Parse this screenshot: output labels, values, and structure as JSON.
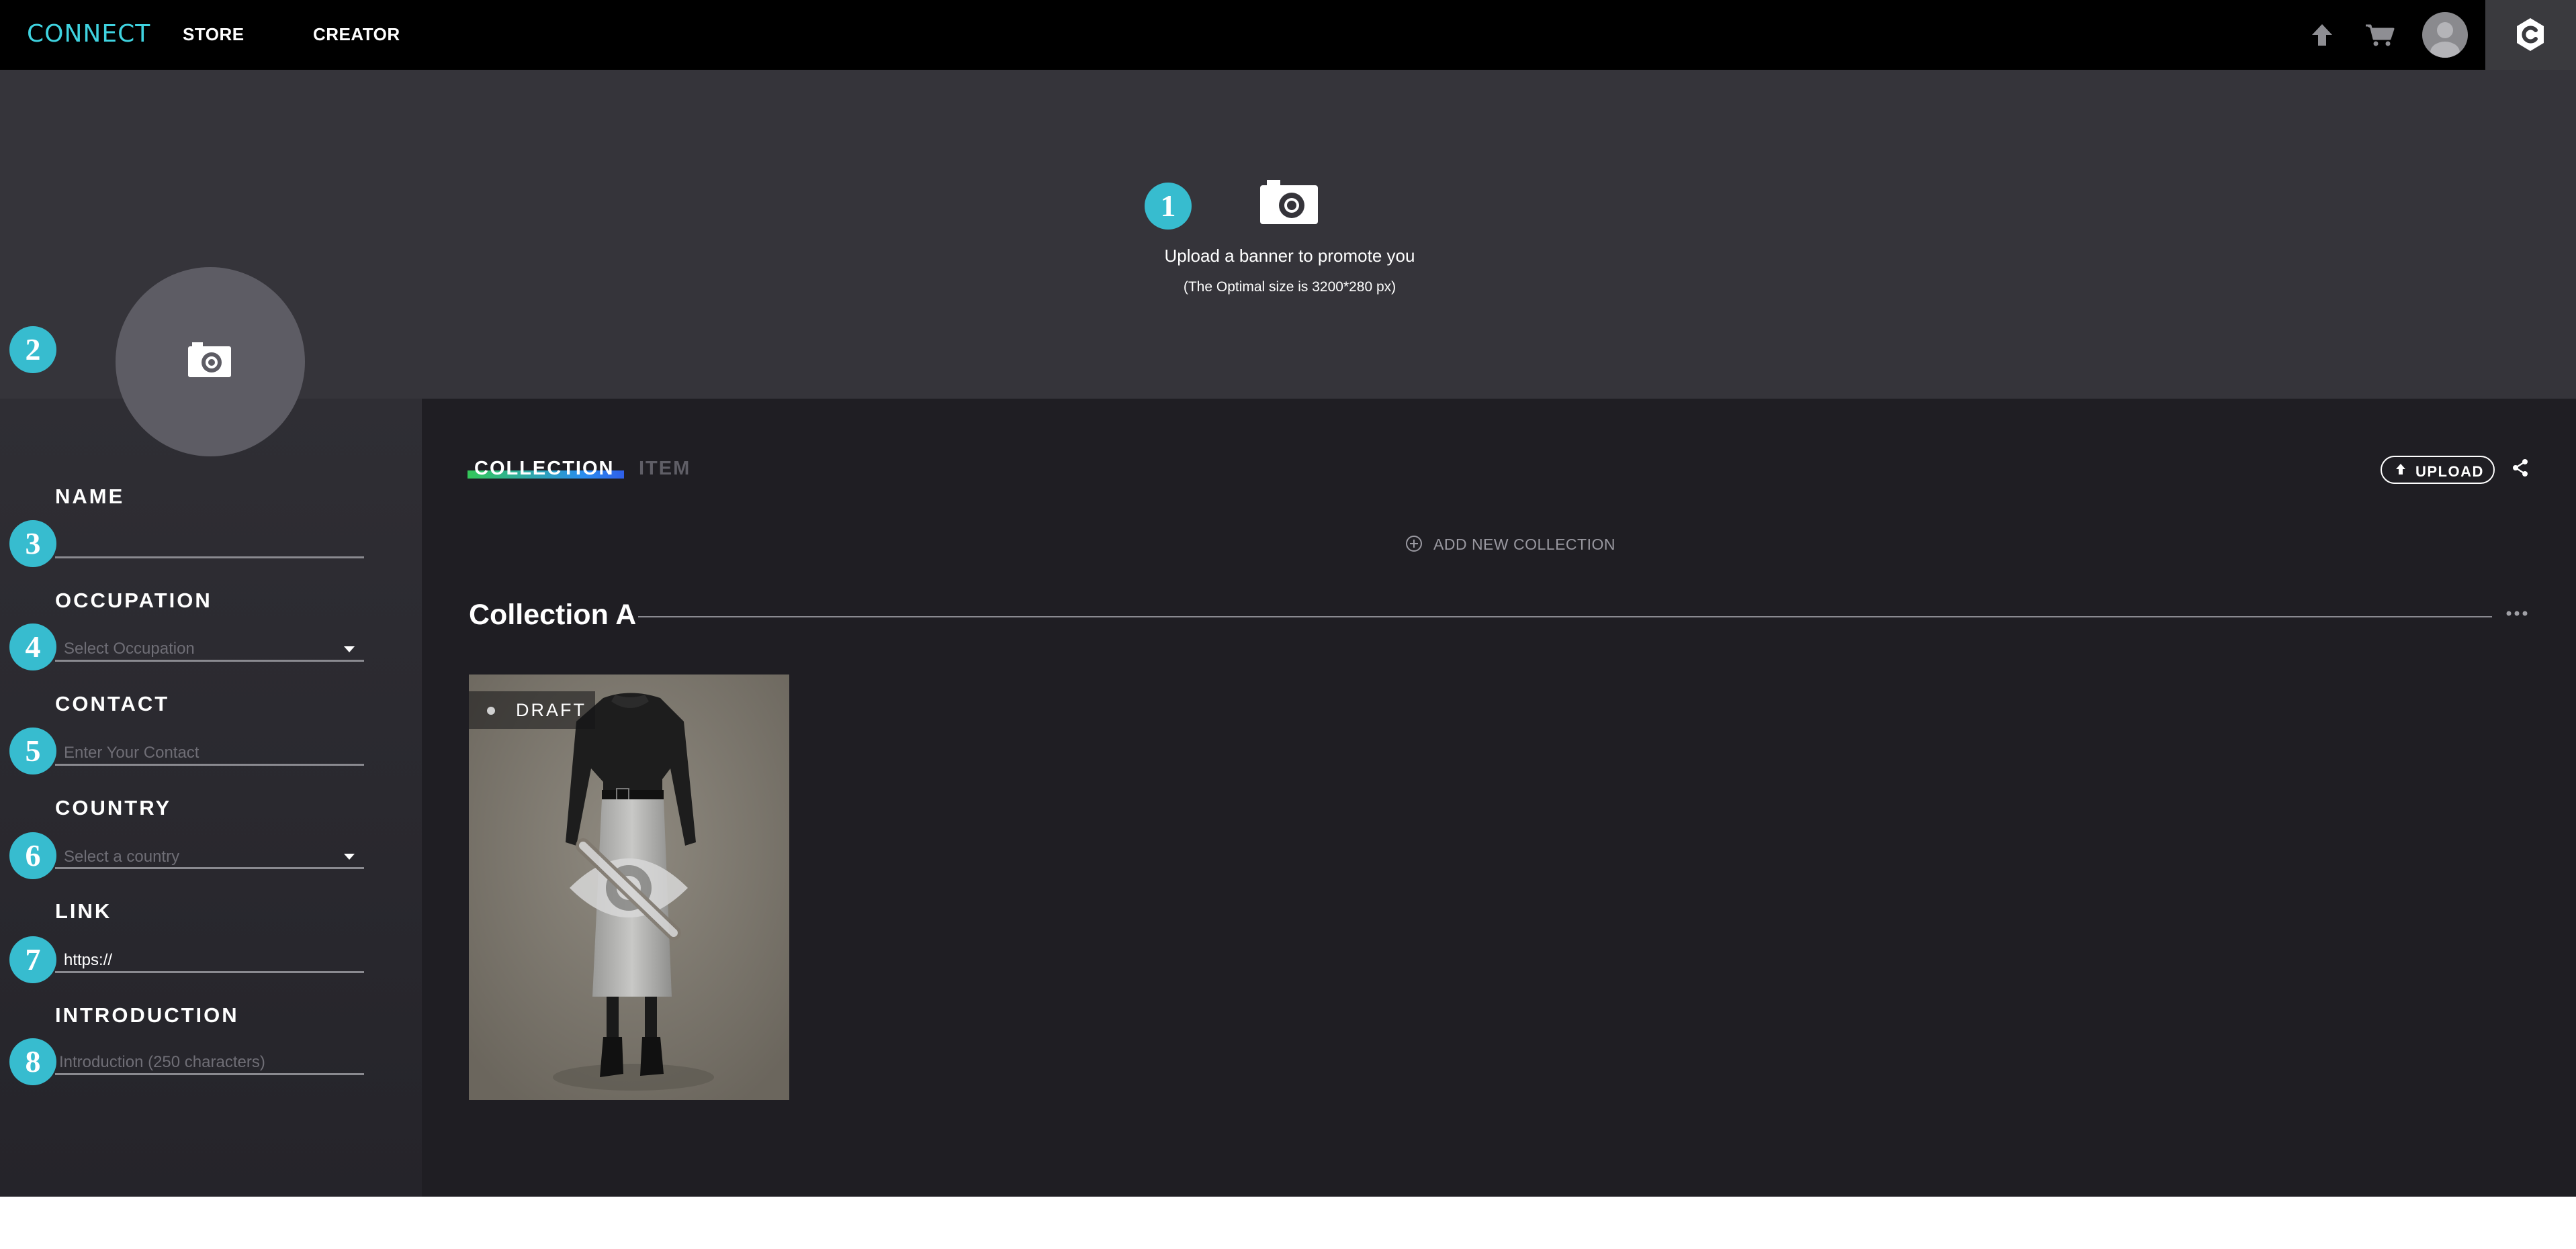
{
  "nav": {
    "logo": "CONNECT",
    "links": [
      "STORE",
      "CREATOR"
    ]
  },
  "banner": {
    "title": "Upload a banner to promote you",
    "subtitle": "(The Optimal size is 3200*280 px)"
  },
  "badges": [
    "1",
    "2",
    "3",
    "4",
    "5",
    "6",
    "7",
    "8"
  ],
  "profile": {
    "fields": {
      "name": {
        "label": "NAME",
        "value": ""
      },
      "occupation": {
        "label": "OCCUPATION",
        "placeholder": "Select Occupation"
      },
      "contact": {
        "label": "CONTACT",
        "placeholder": "Enter Your Contact"
      },
      "country": {
        "label": "COUNTRY",
        "placeholder": "Select a country"
      },
      "link": {
        "label": "LINK",
        "value": "https://"
      },
      "introduction": {
        "label": "INTRODUCTION",
        "placeholder": "Introduction (250 characters)"
      }
    }
  },
  "content": {
    "tabs": [
      {
        "label": "COLLECTION",
        "active": true
      },
      {
        "label": "ITEM",
        "active": false
      }
    ],
    "upload_label": "UPLOAD",
    "add_collection_label": "ADD NEW COLLECTION",
    "collections": [
      {
        "title": "Collection A",
        "items": [
          {
            "status": "DRAFT",
            "hidden": true
          }
        ]
      }
    ]
  },
  "colors": {
    "accent": "#37bccf",
    "logo": "#3fd3e0",
    "tab_underline_start": "#34c759",
    "tab_underline_end": "#2f5fe8"
  }
}
